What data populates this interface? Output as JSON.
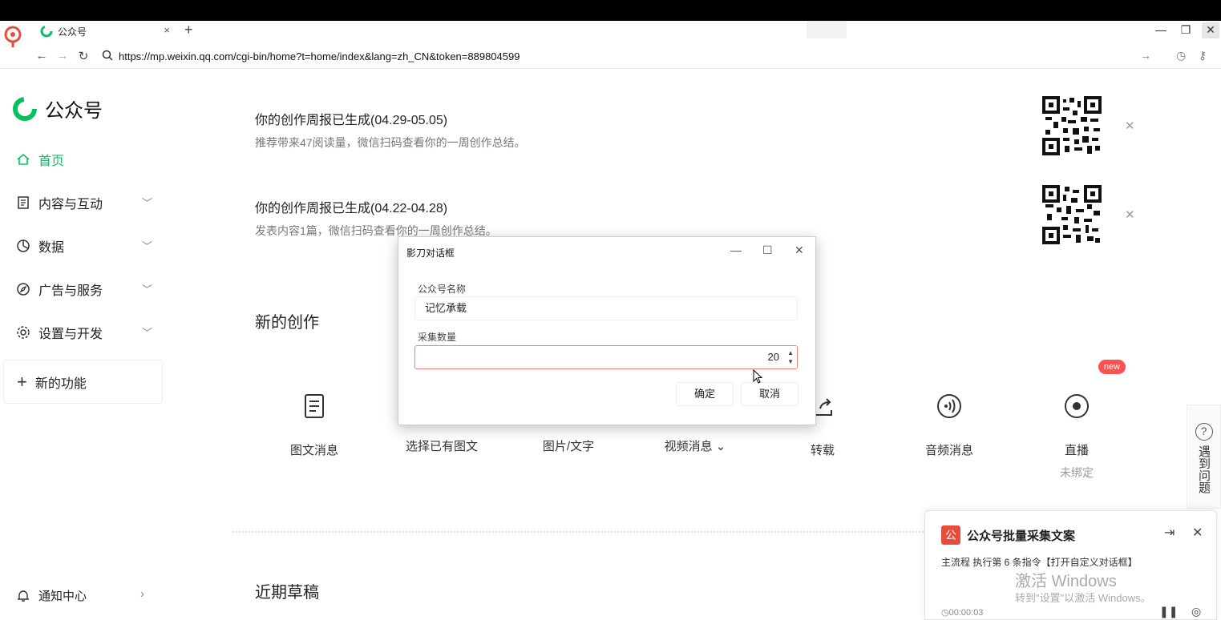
{
  "browser": {
    "tab_title": "公众号",
    "tab_close": "×",
    "new_tab": "+",
    "url": "https://mp.weixin.qq.com/cgi-bin/home?t=home/index&lang=zh_CN&token=889804599",
    "win_minimize": "—",
    "win_restore": "❐",
    "win_close": "✕"
  },
  "sidebar": {
    "brand": "公众号",
    "items": [
      {
        "label": "首页",
        "icon": "home-icon",
        "active": true
      },
      {
        "label": "内容与互动",
        "icon": "document-icon"
      },
      {
        "label": "数据",
        "icon": "chart-icon"
      },
      {
        "label": "广告与服务",
        "icon": "compass-icon"
      },
      {
        "label": "设置与开发",
        "icon": "gear-icon"
      }
    ],
    "new_feature": "新的功能",
    "notify": "通知中心"
  },
  "reports": [
    {
      "title": "你的创作周报已生成(04.29-05.05)",
      "subtitle": "推荐带来47阅读量，微信扫码查看你的一周创作总结。"
    },
    {
      "title": "你的创作周报已生成(04.22-04.28)",
      "subtitle": "发表内容1篇，微信扫码查看你的一周创作总结。"
    }
  ],
  "sections": {
    "new_creation": "新的创作",
    "recent_drafts": "近期草稿"
  },
  "creations": [
    {
      "label": "图文消息"
    },
    {
      "label": "选择已有图文"
    },
    {
      "label": "图片/文字"
    },
    {
      "label": "视频消息"
    },
    {
      "label": "转载"
    },
    {
      "label": "音频消息"
    },
    {
      "label": "直播",
      "sub": "未绑定"
    }
  ],
  "new_badge": "new",
  "help": {
    "text": "遇到问题",
    "mark": "?"
  },
  "dialog": {
    "title": "影刀对话框",
    "field1_label": "公众号名称",
    "field1_value": "记忆承载",
    "field2_label": "采集数量",
    "field2_value": "20",
    "ok": "确定",
    "cancel": "取消"
  },
  "panel": {
    "logo": "公",
    "title": "公众号批量采集文案",
    "step": "主流程 执行第 6 条指令【打开自定义对话框】",
    "activate_line1": "激活 Windows",
    "activate_line2": "转到\"设置\"以激活 Windows。",
    "time": "00:00:03"
  },
  "colors": {
    "accent": "#07c160",
    "badge": "#fa5151",
    "error_border": "#f08080",
    "panel_logo": "#e84c3d"
  }
}
